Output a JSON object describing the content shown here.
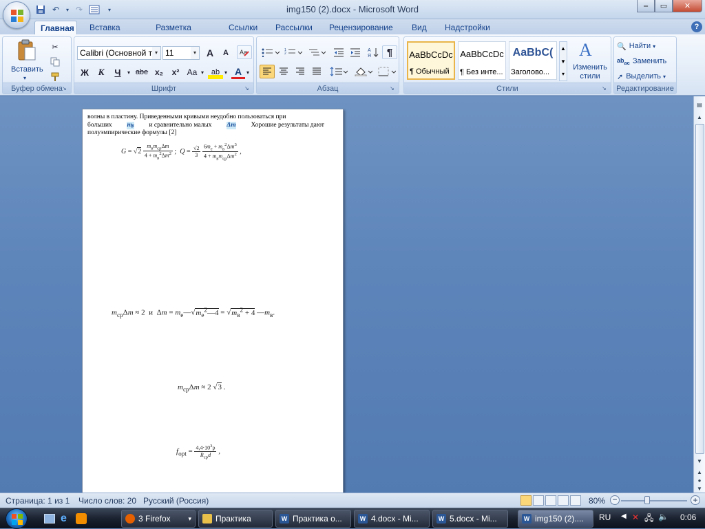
{
  "window": {
    "title": "img150 (2).docx - Microsoft Word",
    "minimize": "‒",
    "maximize": "▭",
    "close": "✕"
  },
  "tabs": [
    "Главная",
    "Вставка",
    "Разметка страницы",
    "Ссылки",
    "Рассылки",
    "Рецензирование",
    "Вид",
    "Надстройки"
  ],
  "ribbon": {
    "clipboard": {
      "paste_label": "Вставить",
      "group_label": "Буфер обмена"
    },
    "font": {
      "font_name": "Calibri (Основной те",
      "font_size": "11",
      "bold": "Ж",
      "italic": "К",
      "underline": "Ч",
      "strike": "abe",
      "subscript": "x₂",
      "superscript": "x²",
      "change_case": "Aa",
      "grow": "A",
      "shrink": "A",
      "highlight": "ab",
      "font_color": "A",
      "group_label": "Шрифт"
    },
    "paragraph": {
      "pilcrow": "¶",
      "group_label": "Абзац"
    },
    "styles": {
      "items": [
        {
          "preview": "AaBbCcDc",
          "name": "¶ Обычный"
        },
        {
          "preview": "AaBbCcDc",
          "name": "¶ Без инте..."
        },
        {
          "preview": "AaBbC(",
          "name": "Заголово..."
        }
      ],
      "change_styles": "Изменить стили",
      "group_label": "Стили"
    },
    "editing": {
      "find": "Найти",
      "replace": "Заменить",
      "select": "Выделить",
      "group_label": "Редактирование"
    }
  },
  "document": {
    "para_line1": "волны в пластину. Приведенными кривыми неудобно пользоваться при",
    "para_line2_a": "больших",
    "para_line2_hl1": "mᵦ",
    "para_line2_b": "и сравнительно малых",
    "para_line2_hl2": "Δm",
    "para_line2_c": "Хорошие результаты дают",
    "para_line3": "полуэмпирические формулы [2]"
  },
  "status": {
    "page": "Страница: 1 из 1",
    "words": "Число слов: 20",
    "language": "Русский (Россия)",
    "zoom": "80%"
  },
  "taskbar": {
    "items": [
      "3 Firefox",
      "Практика",
      "Практика о...",
      "4.docx - Mi...",
      "5.docx - Mi...",
      "img150 (2)...."
    ],
    "lang": "RU",
    "clock": "0:06"
  }
}
